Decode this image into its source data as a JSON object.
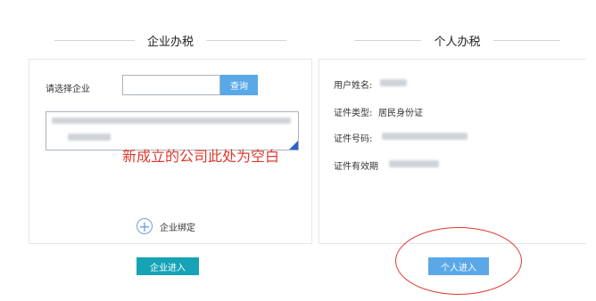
{
  "enterprise": {
    "title": "企业办税",
    "select_label": "请选择企业",
    "query_button": "查询",
    "annotation": "新成立的公司此处为空白",
    "bind_label": "企业绑定",
    "enter_button": "企业进入"
  },
  "personal": {
    "title": "个人办税",
    "fields": [
      {
        "label": "用户姓名:",
        "value": ""
      },
      {
        "label": "证件类型:",
        "value": "居民身份证"
      },
      {
        "label": "证件号码:",
        "value": ""
      },
      {
        "label": "证件有效期",
        "value": ""
      }
    ],
    "enter_button": "个人进入"
  },
  "colors": {
    "accent_blue": "#5ba8e8",
    "teal_button": "#16a3b6",
    "annotation_red": "#e03a2f"
  }
}
